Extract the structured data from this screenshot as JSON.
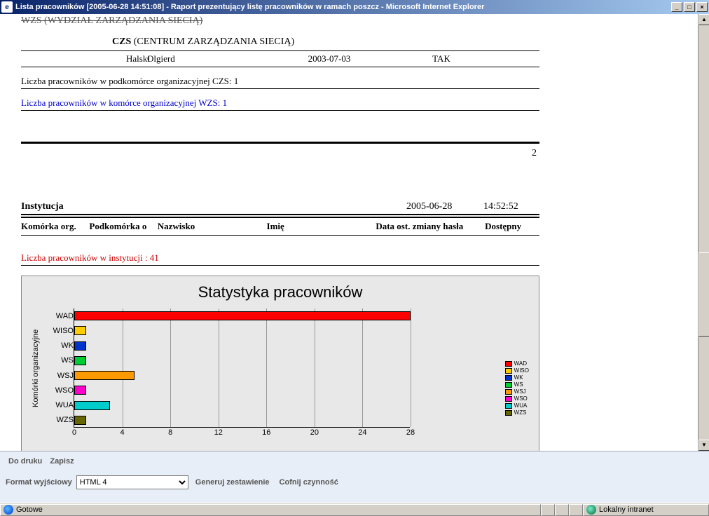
{
  "window": {
    "title": "Lista pracowników [2005-06-28 14:51:08] - Raport prezentujący listę pracowników w ramach poszcz - Microsoft Internet Explorer"
  },
  "report": {
    "wzs_header": "WZS (WYDZIAŁ ZARZĄDZANIA SIECIĄ)",
    "czs_abbr": "CZS",
    "czs_full": " (CENTRUM ZARZĄDZANIA SIECIĄ)",
    "employee": {
      "surname": "Halski",
      "firstname": "Olgierd",
      "date": "2003-07-03",
      "avail": "TAK"
    },
    "count_czs": "Liczba pracowników w podkomórce organizacyjnej CZS:  1",
    "count_wzs": "Liczba pracowników w komórce organizacyjnej WZS:  1",
    "page_number": "2",
    "inst_label": "Instytucja",
    "inst_date": "2005-06-28",
    "inst_time": "14:52:52",
    "headers": {
      "h1": "Komórka org.",
      "h2": "Podkomórka o",
      "h3": "Nazwisko",
      "h4": "Imię",
      "h5": "Data ost. zmiany hasła",
      "h6": "Dostępny"
    },
    "count_inst": "Liczba pracowników w instytucji :  41"
  },
  "chart_data": {
    "type": "bar",
    "orientation": "horizontal",
    "title": "Statystyka pracowników",
    "ylabel": "Komórki organizacyjne",
    "xlim": [
      0,
      28
    ],
    "xticks": [
      0,
      4,
      8,
      12,
      16,
      20,
      24,
      28
    ],
    "categories": [
      "WAD",
      "WISO",
      "WK",
      "WS",
      "WSJ",
      "WSO",
      "WUA",
      "WZS"
    ],
    "values": [
      28,
      1,
      1,
      1,
      5,
      1,
      3,
      1
    ],
    "colors": [
      "#ff0000",
      "#ffcc00",
      "#0033cc",
      "#00cc33",
      "#ff9900",
      "#ff00cc",
      "#00cccc",
      "#666600"
    ],
    "legend": [
      "WAD",
      "WISO",
      "WK",
      "WS",
      "WSJ",
      "WSO",
      "WUA",
      "WZS"
    ]
  },
  "toolbar": {
    "print": "Do druku",
    "save": "Zapisz",
    "format_label": "Format wyjściowy",
    "format_value": "HTML 4",
    "generate": "Generuj zestawienie",
    "undo": "Cofnij czynność"
  },
  "status": {
    "ready": "Gotowe",
    "zone": "Lokalny intranet"
  }
}
